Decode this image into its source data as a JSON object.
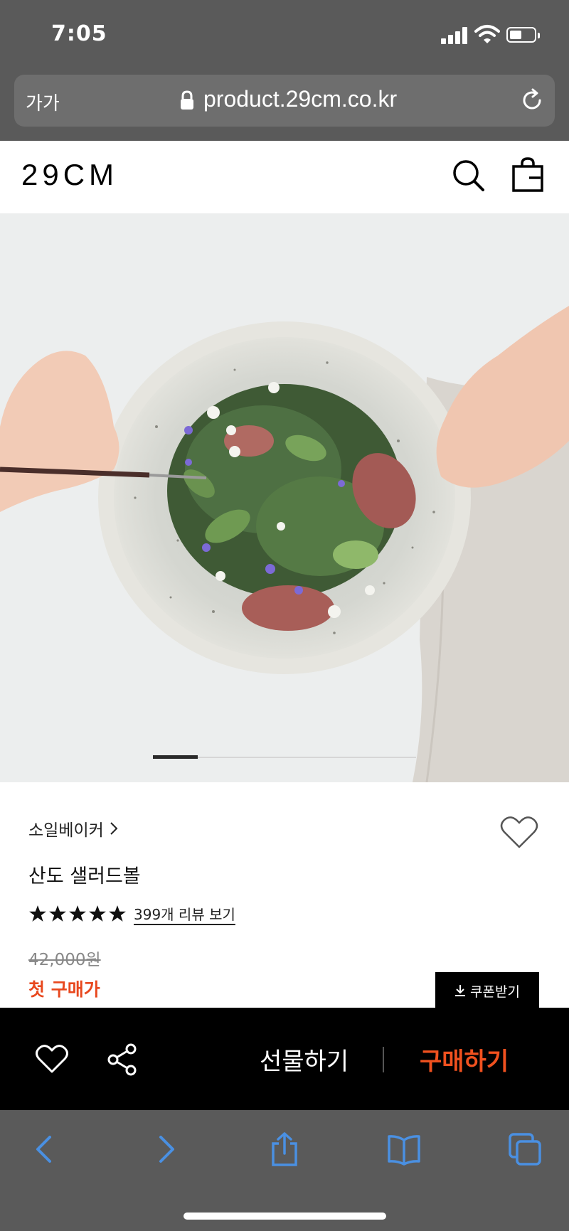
{
  "status_bar": {
    "time": "7:05"
  },
  "address_bar": {
    "text_size_label": "가가",
    "url": "product.29cm.co.kr"
  },
  "header": {
    "logo": "29CM"
  },
  "product": {
    "brand": "소일베이커",
    "name": "산도 샐러드볼",
    "rating_stars": 5,
    "review_link": "399개 리뷰 보기",
    "original_price": "42,000원",
    "first_purchase_label": "첫 구매가",
    "coupon_button": "쿠폰받기",
    "image_slide_progress": 0.17
  },
  "purchase_bar": {
    "gift_label": "선물하기",
    "buy_label": "구매하기"
  },
  "colors": {
    "accent": "#f0511f",
    "price_red": "#e8481e",
    "chrome": "#5a5a5a",
    "safari_blue": "#4a90e2"
  },
  "icons": [
    "signal-icon",
    "wifi-icon",
    "battery-icon",
    "lock-icon",
    "reload-icon",
    "search-icon",
    "bag-icon",
    "heart-icon",
    "star-icon",
    "download-icon",
    "share-icon",
    "back-icon",
    "forward-icon",
    "share-sheet-icon",
    "bookmarks-icon",
    "tabs-icon"
  ]
}
